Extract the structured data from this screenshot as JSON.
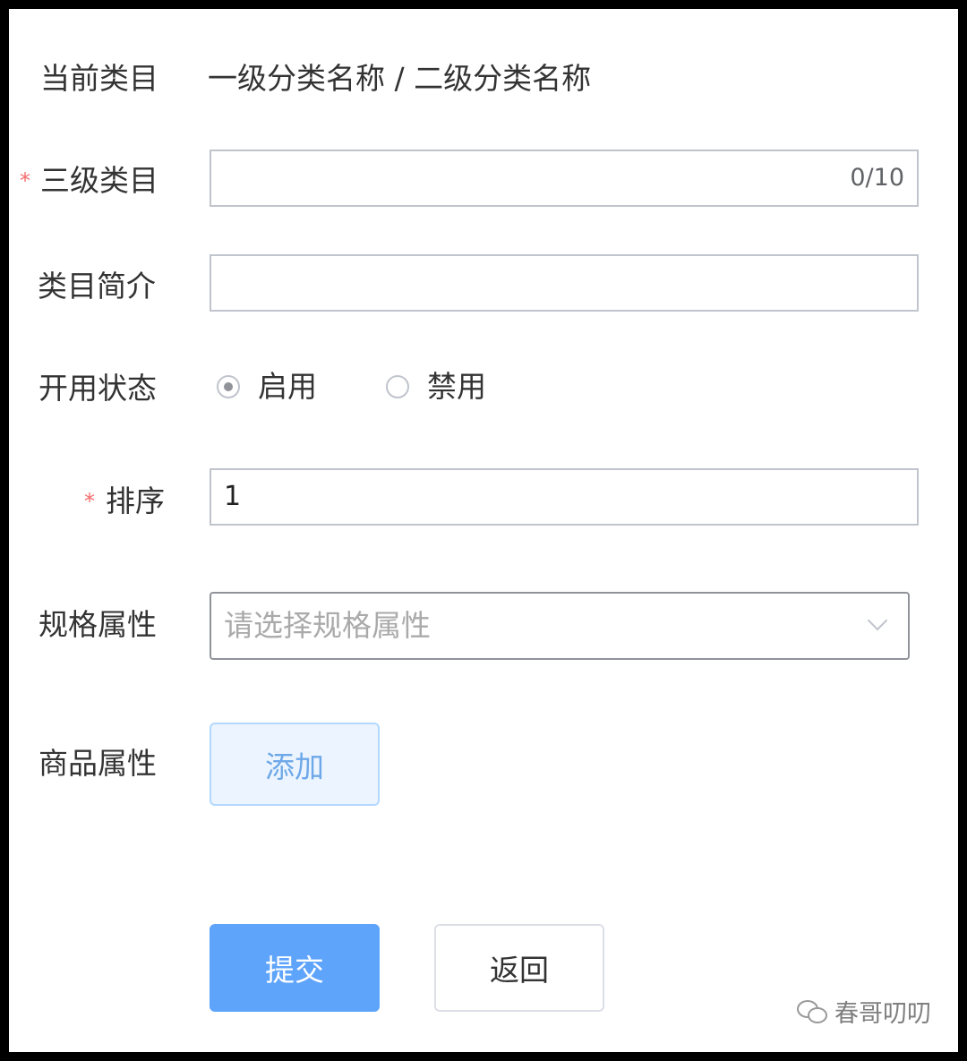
{
  "current_category": {
    "label": "当前类目",
    "path": "一级分类名称  / 二级分类名称"
  },
  "third_category": {
    "required_mark": "*",
    "label": "三级类目",
    "value": "",
    "counter": "0/10"
  },
  "category_intro": {
    "label": "类目简介",
    "value": ""
  },
  "status": {
    "label": "开用状态",
    "options": [
      {
        "label": "启用",
        "checked": true
      },
      {
        "label": "禁用",
        "checked": false
      }
    ]
  },
  "sort": {
    "required_mark": "*",
    "label": "排序",
    "value": "1"
  },
  "spec_attr": {
    "label": "规格属性",
    "placeholder": "请选择规格属性"
  },
  "product_attr": {
    "label": "商品属性",
    "add_label": "添加"
  },
  "actions": {
    "submit_label": "提交",
    "back_label": "返回"
  },
  "watermark": {
    "text": "春哥叨叨",
    "icon": "wechat-icon"
  }
}
